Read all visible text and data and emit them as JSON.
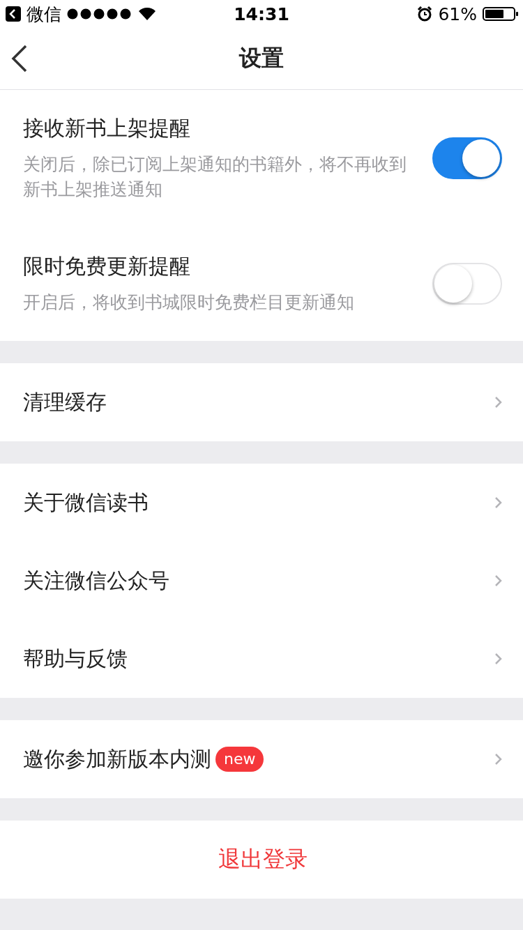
{
  "status_bar": {
    "back_app": "微信",
    "time": "14:31",
    "battery": "61%"
  },
  "nav": {
    "title": "设置"
  },
  "sections": [
    {
      "items": [
        {
          "kind": "toggle",
          "title": "接收新书上架提醒",
          "description": "关闭后，除已订阅上架通知的书籍外，将不再收到新书上架推送通知",
          "on": true
        },
        {
          "kind": "toggle",
          "title": "限时免费更新提醒",
          "description": "开启后，将收到书城限时免费栏目更新通知",
          "on": false
        }
      ]
    },
    {
      "items": [
        {
          "kind": "link",
          "title": "清理缓存"
        }
      ]
    },
    {
      "items": [
        {
          "kind": "link",
          "title": "关于微信读书"
        },
        {
          "kind": "link",
          "title": "关注微信公众号"
        },
        {
          "kind": "link",
          "title": "帮助与反馈"
        }
      ]
    },
    {
      "items": [
        {
          "kind": "link",
          "title": "邀你参加新版本内测",
          "badge": "new"
        }
      ]
    },
    {
      "items": [
        {
          "kind": "action",
          "title": "退出登录"
        }
      ]
    }
  ]
}
